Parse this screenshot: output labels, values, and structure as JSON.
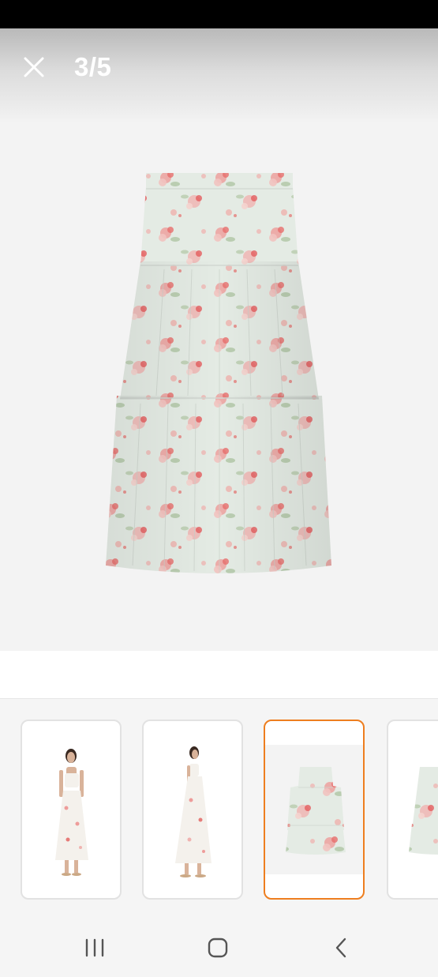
{
  "viewer": {
    "counter": "3/5",
    "close_icon": "close-icon"
  },
  "thumbnails": [
    {
      "name": "model-front-thumbnail",
      "selected": false
    },
    {
      "name": "model-side-thumbnail",
      "selected": false
    },
    {
      "name": "skirt-flat-thumbnail",
      "selected": true
    },
    {
      "name": "skirt-flat-alt-thumbnail",
      "selected": false
    }
  ],
  "colors": {
    "accent": "#ee7e1f",
    "status_bar": "#000000",
    "background": "#f3f3f3"
  },
  "nav": {
    "recents_icon": "recents-icon",
    "home_icon": "home-icon",
    "back_icon": "back-icon"
  }
}
